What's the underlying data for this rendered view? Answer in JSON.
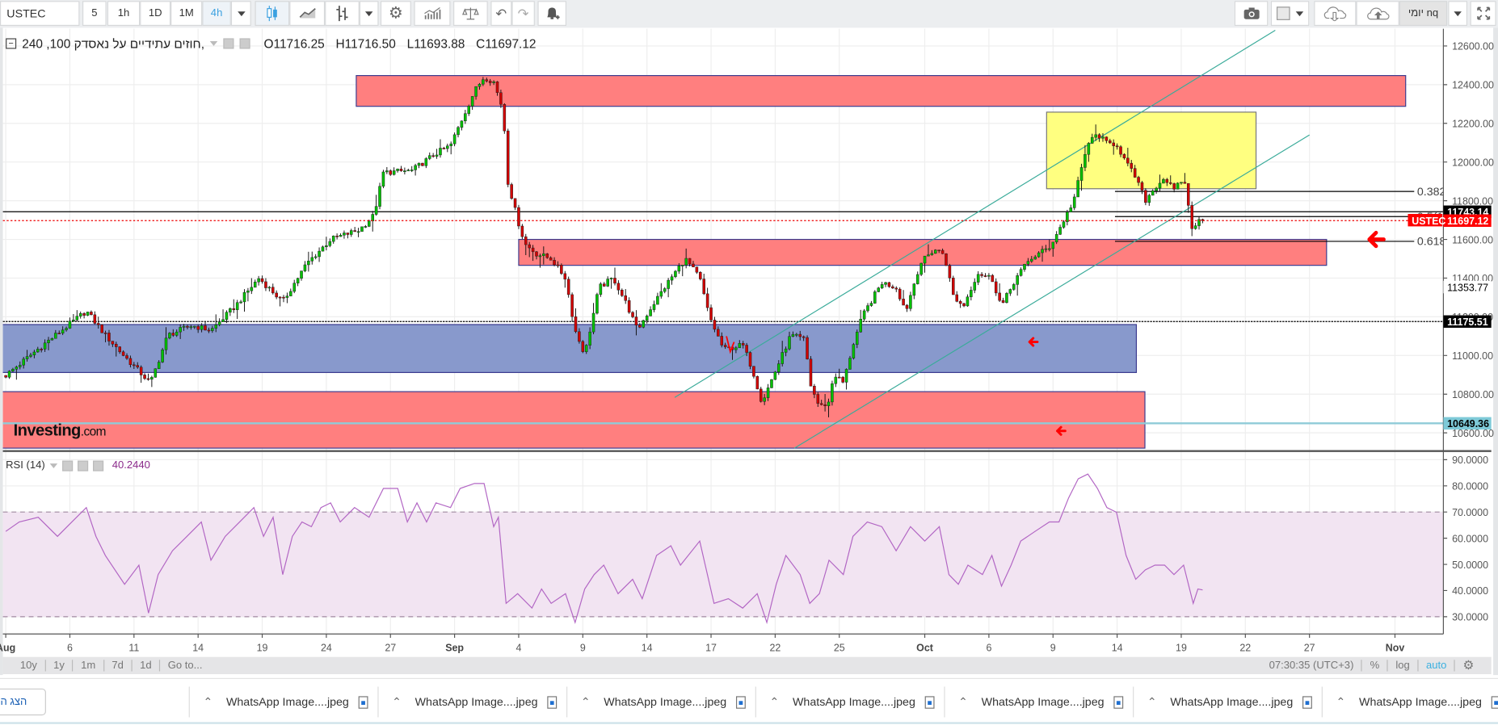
{
  "toolbar": {
    "symbol": "USTEC",
    "intervals": [
      "5",
      "1h",
      "1D",
      "1M",
      "4h"
    ],
    "active_interval": "4h",
    "layout_name": "יומי nq"
  },
  "legend": {
    "title": ",חוזים עתידיים על נאסדק 100, 240",
    "open": "O11716.25",
    "high": "H11716.50",
    "low": "L11693.88",
    "close": "C11697.12"
  },
  "rsi_legend": {
    "label": "RSI (14)",
    "value": "40.2440"
  },
  "logo": {
    "brand": "Investing",
    "suffix": ".com"
  },
  "bottom_bar": {
    "ranges": [
      "10y",
      "1y",
      "1m",
      "7d",
      "1d",
      "Go to..."
    ],
    "time": "07:30:35 (UTC+3)",
    "percent": "%",
    "log": "log",
    "auto": "auto"
  },
  "taskbar": {
    "show_all": "הצג הכל",
    "downloads": [
      "WhatsApp Image....jpeg",
      "WhatsApp Image....jpeg",
      "WhatsApp Image....jpeg",
      "WhatsApp Image....jpeg",
      "WhatsApp Image....jpeg",
      "WhatsApp Image....jpeg",
      "WhatsApp Image....jpeg"
    ]
  },
  "colors": {
    "up": "#00c000",
    "down": "#d10000",
    "zone_red": "#ff7f7f",
    "zone_blue": "#8899cc",
    "zone_yellow": "#ffff80",
    "channel": "#3aab9a",
    "rsi_line": "#b266c4",
    "rsi_band": "#f2e4f2",
    "accent": "#3aa0e0"
  },
  "chart_data": [
    {
      "type": "candlestick",
      "timeframe": "4h",
      "x_unit": "trading days since Aug 3",
      "ylim": [
        10520,
        12700
      ],
      "y_ticks": [
        12600,
        12400,
        12200,
        12000,
        11800,
        11600,
        11400,
        11200,
        11000,
        10800,
        10600
      ],
      "x_ticks": [
        {
          "label": "Aug",
          "day": 0
        },
        {
          "label": "6",
          "day": 3
        },
        {
          "label": "11",
          "day": 6
        },
        {
          "label": "14",
          "day": 9
        },
        {
          "label": "19",
          "day": 12
        },
        {
          "label": "24",
          "day": 15
        },
        {
          "label": "27",
          "day": 18
        },
        {
          "label": "Sep",
          "day": 21
        },
        {
          "label": "4",
          "day": 24
        },
        {
          "label": "9",
          "day": 27
        },
        {
          "label": "14",
          "day": 30
        },
        {
          "label": "17",
          "day": 33
        },
        {
          "label": "22",
          "day": 36
        },
        {
          "label": "25",
          "day": 39
        },
        {
          "label": "Oct",
          "day": 43
        },
        {
          "label": "6",
          "day": 46
        },
        {
          "label": "9",
          "day": 49
        },
        {
          "label": "14",
          "day": 52
        },
        {
          "label": "19",
          "day": 55
        },
        {
          "label": "22",
          "day": 58
        },
        {
          "label": "27",
          "day": 61
        },
        {
          "label": "Nov",
          "day": 65
        }
      ],
      "price_path": [
        [
          0,
          10897
        ],
        [
          1.75,
          11055
        ],
        [
          3.77,
          11230
        ],
        [
          4.66,
          11105
        ],
        [
          5.56,
          10995
        ],
        [
          6.77,
          10857
        ],
        [
          7.58,
          11105
        ],
        [
          8.7,
          11155
        ],
        [
          9.6,
          11130
        ],
        [
          10.72,
          11253
        ],
        [
          11.84,
          11400
        ],
        [
          12.96,
          11278
        ],
        [
          14.08,
          11475
        ],
        [
          15.2,
          11600
        ],
        [
          16.55,
          11650
        ],
        [
          17.22,
          11724
        ],
        [
          17.67,
          11946
        ],
        [
          19.01,
          11956
        ],
        [
          20.13,
          12045
        ],
        [
          20.81,
          12085
        ],
        [
          21.26,
          12200
        ],
        [
          21.93,
          12367
        ],
        [
          22.38,
          12440
        ],
        [
          22.83,
          12415
        ],
        [
          23.27,
          12268
        ],
        [
          23.5,
          11897
        ],
        [
          23.95,
          11700
        ],
        [
          24.3,
          11575
        ],
        [
          24.84,
          11525
        ],
        [
          25.52,
          11500
        ],
        [
          26.19,
          11400
        ],
        [
          26.64,
          11130
        ],
        [
          27.09,
          11005
        ],
        [
          27.76,
          11352
        ],
        [
          28.43,
          11400
        ],
        [
          29.1,
          11253
        ],
        [
          29.55,
          11130
        ],
        [
          30.22,
          11253
        ],
        [
          31.12,
          11400
        ],
        [
          31.79,
          11500
        ],
        [
          32.47,
          11400
        ],
        [
          32.91,
          11204
        ],
        [
          33.59,
          11030
        ],
        [
          34.48,
          11055
        ],
        [
          34.93,
          10930
        ],
        [
          35.38,
          10758
        ],
        [
          36.05,
          10930
        ],
        [
          36.73,
          11105
        ],
        [
          37.4,
          11080
        ],
        [
          37.62,
          10858
        ],
        [
          38.07,
          10733
        ],
        [
          38.52,
          10758
        ],
        [
          38.74,
          10907
        ],
        [
          39.19,
          10858
        ],
        [
          39.64,
          11055
        ],
        [
          40.09,
          11204
        ],
        [
          40.99,
          11377
        ],
        [
          41.66,
          11352
        ],
        [
          42.11,
          11230
        ],
        [
          42.78,
          11475
        ],
        [
          43.45,
          11550
        ],
        [
          43.9,
          11525
        ],
        [
          44.35,
          11303
        ],
        [
          44.8,
          11253
        ],
        [
          45.47,
          11427
        ],
        [
          46.14,
          11400
        ],
        [
          46.59,
          11253
        ],
        [
          47.26,
          11400
        ],
        [
          47.94,
          11500
        ],
        [
          48.83,
          11560
        ],
        [
          49.28,
          11650
        ],
        [
          49.96,
          11800
        ],
        [
          50.4,
          11995
        ],
        [
          50.63,
          12095
        ],
        [
          51.08,
          12145
        ],
        [
          51.52,
          12095
        ],
        [
          51.97,
          12095
        ],
        [
          52.42,
          11995
        ],
        [
          52.87,
          11920
        ],
        [
          53.32,
          11800
        ],
        [
          53.77,
          11870
        ],
        [
          54.22,
          11920
        ],
        [
          54.66,
          11850
        ],
        [
          55.11,
          11920
        ],
        [
          55.34,
          11773
        ],
        [
          55.56,
          11625
        ],
        [
          55.78,
          11700
        ],
        [
          56.0,
          11697.12
        ]
      ],
      "last_price": 11697.12,
      "price_labels": [
        {
          "value": "11743.14",
          "price": 11743.14,
          "style": "black"
        },
        {
          "value": "11697.12",
          "price": 11697.12,
          "style": "red",
          "tag": "USTEC"
        },
        {
          "value": "11353.77",
          "price": 11353.77,
          "style": "plain"
        },
        {
          "value": "11175.51",
          "price": 11175.51,
          "style": "black"
        },
        {
          "value": "10649.36",
          "price": 10649.36,
          "style": "cyan"
        }
      ],
      "zones": [
        {
          "name": "resistance-zone-top",
          "color": "red",
          "day_from": 16.4,
          "day_to": 65.5,
          "price_low": 12288,
          "price_high": 12447
        },
        {
          "name": "target-zone-yellow",
          "color": "yellow",
          "day_from": 48.7,
          "day_to": 58.5,
          "price_low": 11862,
          "price_high": 12258
        },
        {
          "name": "support-zone-mid",
          "color": "red",
          "day_from": 24.0,
          "day_to": 61.8,
          "price_low": 11466,
          "price_high": 11600
        },
        {
          "name": "support-zone-blue",
          "color": "blue",
          "day_from": -0.2,
          "day_to": 52.9,
          "price_low": 10912,
          "price_high": 11160
        },
        {
          "name": "support-zone-bottom",
          "color": "red",
          "day_from": -0.2,
          "day_to": 53.3,
          "price_low": 10521,
          "price_high": 10813
        }
      ],
      "channel_lines": [
        {
          "from": [
            31.3,
            10783
          ],
          "to": [
            59.4,
            12681
          ]
        },
        {
          "from": [
            36.9,
            10521
          ],
          "to": [
            61.0,
            12140
          ]
        }
      ],
      "fib_levels": [
        {
          "label": "0.382",
          "price": 11848
        },
        {
          "label": "0.5(11",
          "price": 11718
        },
        {
          "label": "0.618",
          "price": 11590
        }
      ],
      "fib_day_range": [
        51.9,
        65.9
      ],
      "annotations": [
        {
          "type": "arrow-left",
          "day": 63.8,
          "price": 11600,
          "size": "large"
        },
        {
          "type": "arrow-left",
          "day": 47.9,
          "price": 11070,
          "size": "small"
        },
        {
          "type": "arrow-left",
          "day": 49.2,
          "price": 10610,
          "size": "small"
        },
        {
          "type": "v-mark",
          "day": 33.9,
          "price": 11050
        }
      ]
    },
    {
      "type": "line",
      "title": "RSI (14)",
      "ylim": [
        20,
        95
      ],
      "y_ticks": [
        90,
        80,
        70,
        60,
        50,
        40,
        30
      ],
      "overbought": 70,
      "oversold": 30,
      "last_value": 40.244,
      "points": [
        [
          0,
          62.6
        ],
        [
          0.63,
          66.2
        ],
        [
          1.52,
          68.0
        ],
        [
          2.42,
          60.7
        ],
        [
          3.09,
          66.2
        ],
        [
          3.77,
          71.7
        ],
        [
          4.22,
          60.7
        ],
        [
          4.66,
          53.4
        ],
        [
          5.56,
          42.4
        ],
        [
          6.23,
          49.7
        ],
        [
          6.68,
          31.4
        ],
        [
          7.13,
          46.1
        ],
        [
          7.8,
          55.2
        ],
        [
          8.48,
          60.7
        ],
        [
          9.15,
          66.2
        ],
        [
          9.6,
          51.6
        ],
        [
          10.27,
          60.7
        ],
        [
          10.94,
          66.2
        ],
        [
          11.61,
          71.7
        ],
        [
          12.06,
          60.7
        ],
        [
          12.51,
          68.0
        ],
        [
          12.96,
          46.1
        ],
        [
          13.41,
          60.7
        ],
        [
          13.86,
          66.2
        ],
        [
          14.3,
          64.4
        ],
        [
          14.75,
          71.7
        ],
        [
          15.2,
          73.5
        ],
        [
          15.65,
          66.2
        ],
        [
          16.32,
          71.7
        ],
        [
          17.0,
          68.0
        ],
        [
          17.67,
          79.0
        ],
        [
          18.34,
          79.0
        ],
        [
          18.79,
          66.2
        ],
        [
          19.24,
          73.5
        ],
        [
          19.69,
          66.2
        ],
        [
          20.13,
          73.5
        ],
        [
          20.81,
          71.7
        ],
        [
          21.26,
          79.0
        ],
        [
          21.93,
          80.9
        ],
        [
          22.38,
          80.9
        ],
        [
          22.83,
          64.4
        ],
        [
          23.05,
          68.0
        ],
        [
          23.41,
          35.1
        ],
        [
          23.95,
          38.8
        ],
        [
          24.62,
          33.3
        ],
        [
          25.07,
          40.6
        ],
        [
          25.52,
          35.1
        ],
        [
          26.19,
          38.8
        ],
        [
          26.64,
          27.8
        ],
        [
          27.09,
          40.6
        ],
        [
          27.53,
          46.1
        ],
        [
          27.98,
          49.7
        ],
        [
          28.65,
          38.8
        ],
        [
          29.33,
          44.3
        ],
        [
          29.78,
          36.9
        ],
        [
          30.45,
          53.4
        ],
        [
          31.12,
          57.1
        ],
        [
          31.57,
          49.7
        ],
        [
          32.47,
          58.9
        ],
        [
          33.14,
          35.1
        ],
        [
          33.81,
          36.9
        ],
        [
          34.48,
          33.3
        ],
        [
          35.16,
          38.8
        ],
        [
          35.61,
          27.8
        ],
        [
          36.05,
          42.4
        ],
        [
          36.5,
          53.4
        ],
        [
          37.17,
          46.1
        ],
        [
          37.62,
          35.1
        ],
        [
          38.07,
          38.8
        ],
        [
          38.52,
          51.6
        ],
        [
          39.19,
          46.1
        ],
        [
          39.64,
          60.7
        ],
        [
          40.31,
          66.2
        ],
        [
          40.99,
          64.4
        ],
        [
          41.66,
          55.2
        ],
        [
          42.33,
          64.4
        ],
        [
          43.0,
          58.9
        ],
        [
          43.68,
          64.4
        ],
        [
          44.13,
          46.1
        ],
        [
          44.57,
          42.4
        ],
        [
          45.02,
          49.7
        ],
        [
          45.7,
          46.1
        ],
        [
          46.14,
          53.4
        ],
        [
          46.59,
          41.7
        ],
        [
          47.04,
          49.7
        ],
        [
          47.49,
          58.9
        ],
        [
          48.16,
          62.6
        ],
        [
          48.83,
          66.2
        ],
        [
          49.28,
          66.2
        ],
        [
          49.73,
          75.4
        ],
        [
          50.18,
          82.7
        ],
        [
          50.63,
          84.5
        ],
        [
          51.08,
          79.0
        ],
        [
          51.52,
          71.7
        ],
        [
          51.97,
          69.9
        ],
        [
          52.42,
          53.4
        ],
        [
          52.87,
          44.3
        ],
        [
          53.32,
          47.9
        ],
        [
          53.77,
          49.7
        ],
        [
          54.22,
          49.7
        ],
        [
          54.66,
          46.1
        ],
        [
          55.11,
          49.7
        ],
        [
          55.56,
          35.1
        ],
        [
          55.78,
          40.6
        ],
        [
          56.0,
          40.24
        ]
      ]
    }
  ]
}
